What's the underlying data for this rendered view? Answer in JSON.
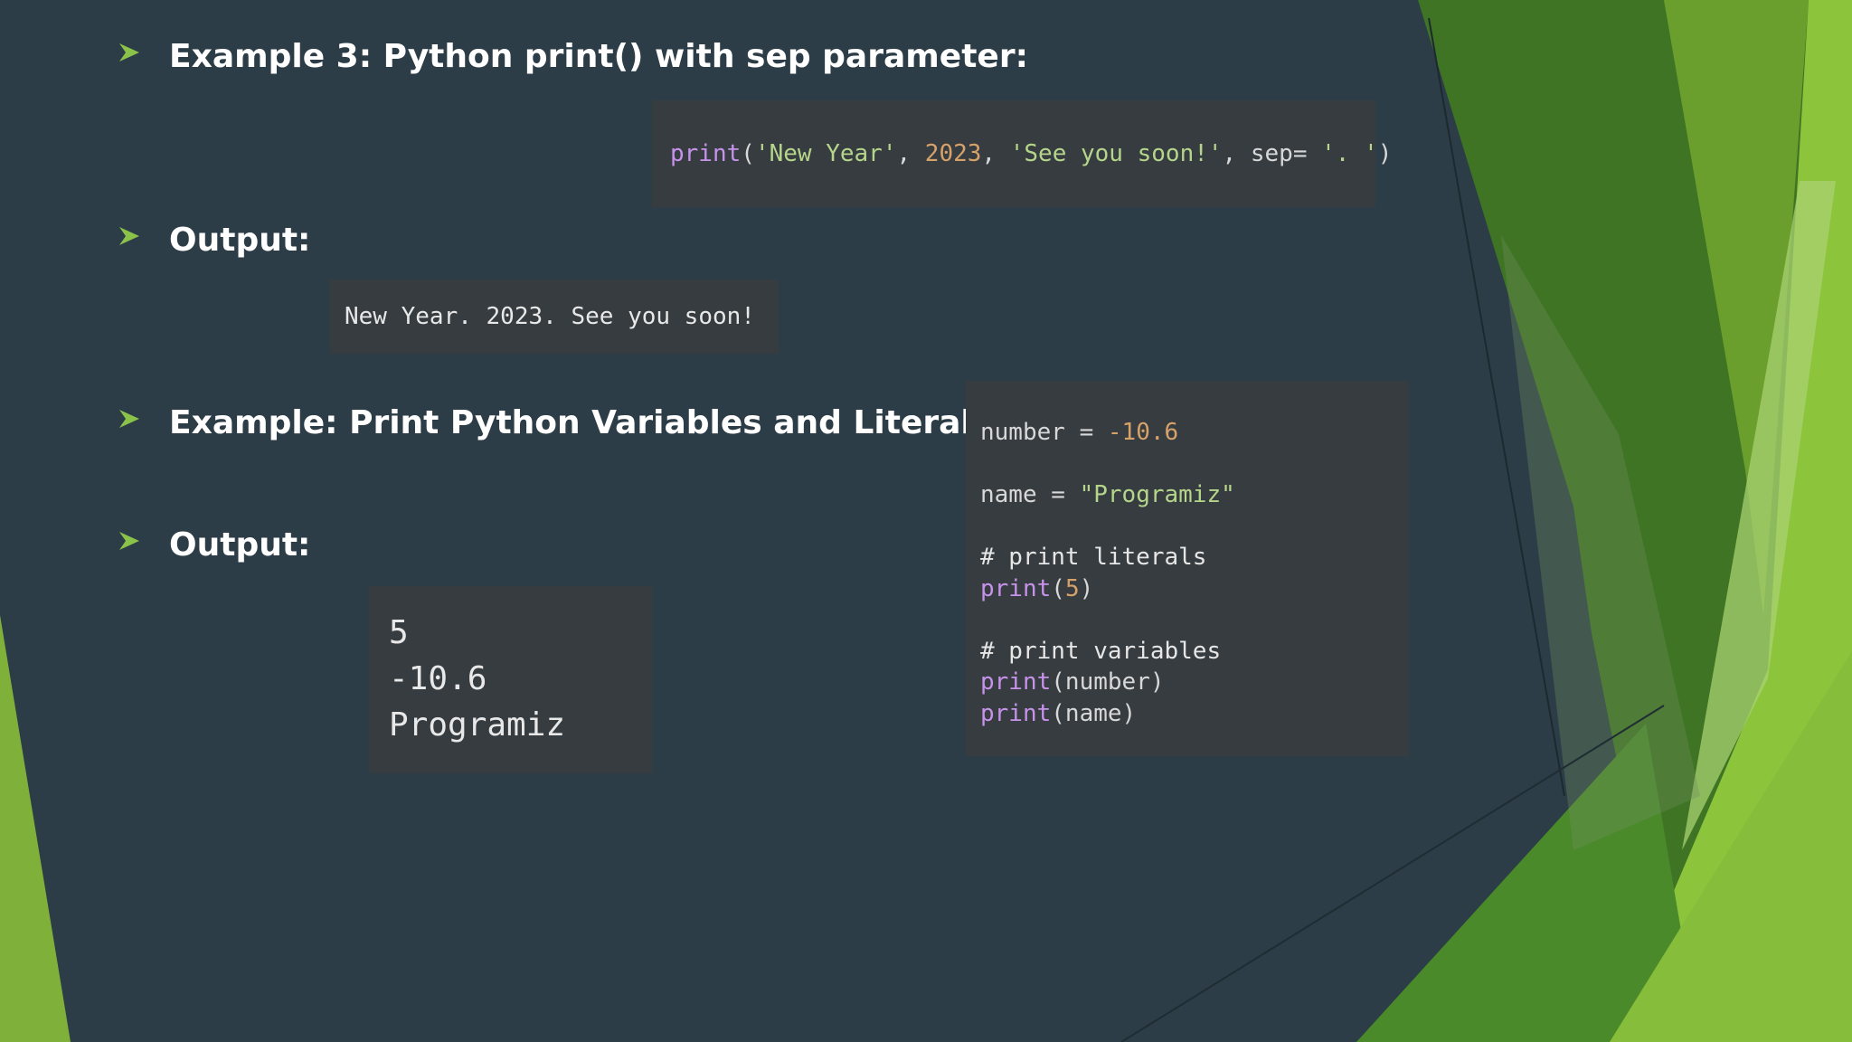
{
  "headings": {
    "example3": "Example 3: Python print() with sep parameter:",
    "output1": "Output:",
    "example_vars": "Example: Print Python Variables and Literals:",
    "output2": "Output:"
  },
  "code1": {
    "fn": "print",
    "open": "(",
    "arg1": "'New Year'",
    "comma1": ", ",
    "arg2": "2023",
    "comma2": ", ",
    "arg3": "'See you soon!'",
    "comma3": ", sep= ",
    "arg4": "'. '",
    "close": ")"
  },
  "output1": {
    "text": "New Year. 2023. See you soon!"
  },
  "code2": {
    "line1_var": "number = ",
    "line1_val": "-10.6",
    "line2_var": "name = ",
    "line2_val": "\"Programiz\"",
    "comment1": "# print literals",
    "l4_fn": "print",
    "l4_open": "(",
    "l4_arg": "5",
    "l4_close": ")",
    "comment2": "# print variables",
    "l6_fn": "print",
    "l6_rest": "(number)",
    "l7_fn": "print",
    "l7_rest": "(name)"
  },
  "output2": {
    "lines": [
      "5",
      "-10.6",
      "Programiz"
    ]
  },
  "colors": {
    "background": "#2c3d47",
    "code_bg": "#363c40",
    "bullet": "#8bc34a",
    "keyword": "#c792ea",
    "string": "#b5d58a",
    "number": "#d7a26a",
    "green_dark": "#3f7a25",
    "green_light": "#8dc43c"
  }
}
